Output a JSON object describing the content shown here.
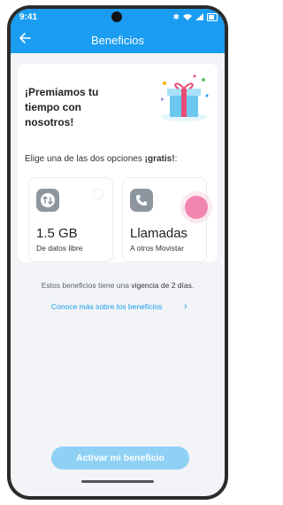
{
  "status_bar": {
    "time": "9:41"
  },
  "app_bar": {
    "title": "Beneficios",
    "back_icon": "arrow-left-icon"
  },
  "promo": {
    "headline": "¡Premiamos tu tiempo con nosotros!",
    "choose_prefix": "Elige una de las dos opciones ",
    "choose_bold": "¡gratis!",
    "choose_suffix": ":"
  },
  "options": [
    {
      "icon": "data-arrows-icon",
      "value": "1.5 GB",
      "caption": "De datos libre"
    },
    {
      "icon": "phone-icon",
      "value": "Llamadas",
      "caption": "A otros Movistar"
    }
  ],
  "validity": {
    "text": "Estos beneficios tiene una ",
    "bold": "vigencia de 2 días",
    "end": "."
  },
  "more_link": {
    "label": "Conoce más sobre los beneficios"
  },
  "cta": {
    "label": "Activar mi beneficio"
  },
  "colors": {
    "primary": "#1a9cf0",
    "cta_disabled": "#8fd1f5",
    "tap_indicator": "#f06fa3"
  }
}
